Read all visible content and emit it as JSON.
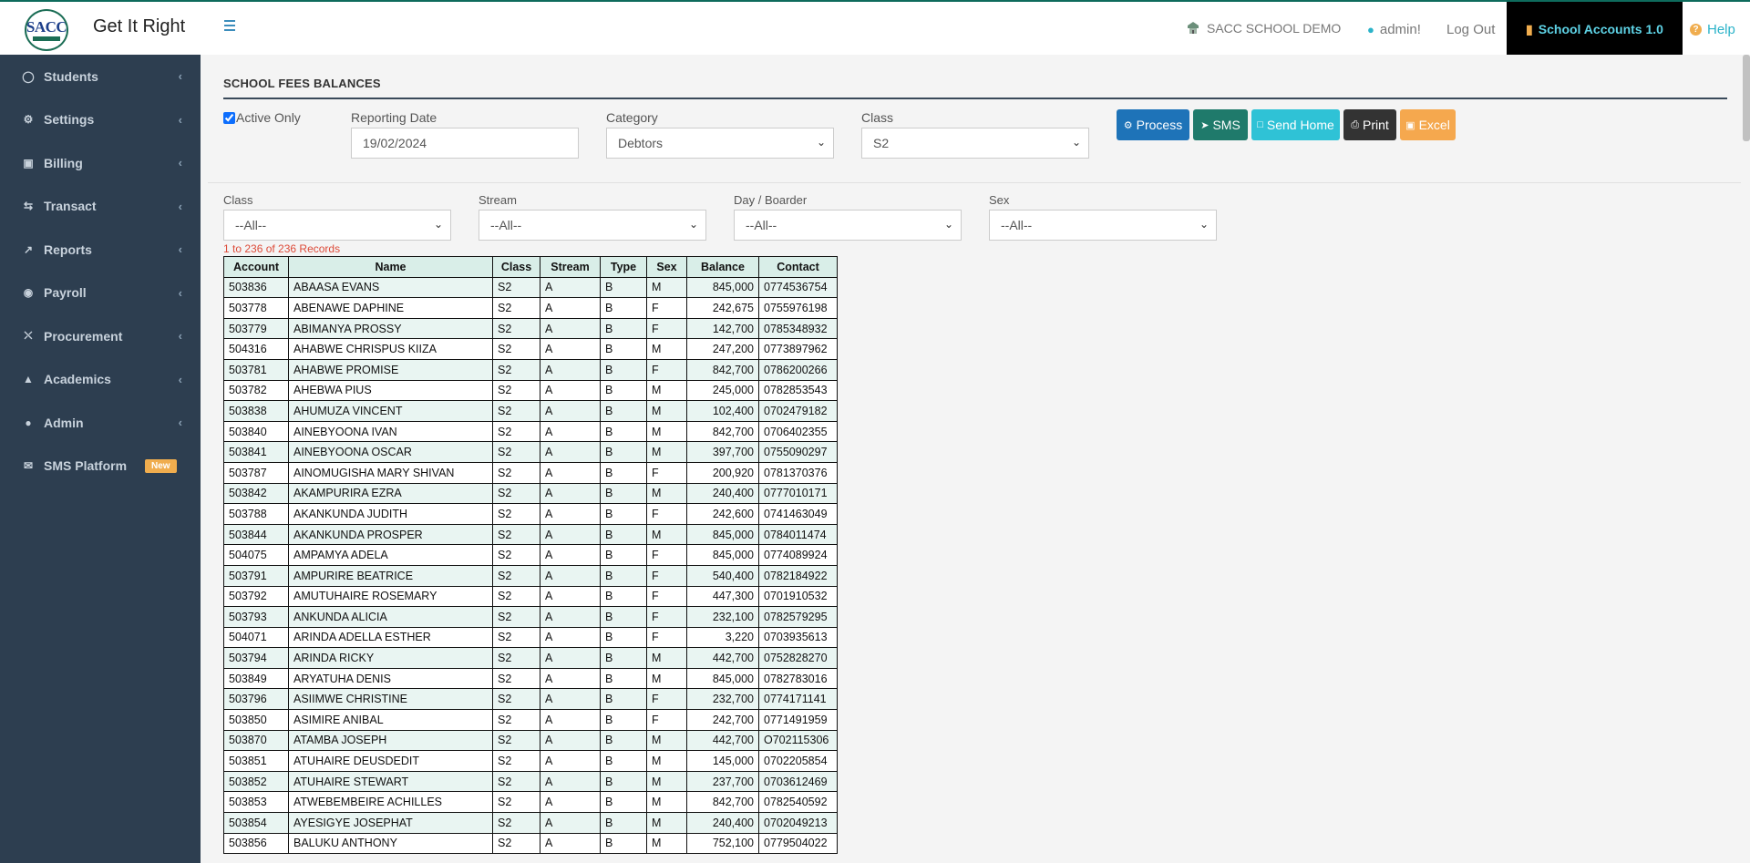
{
  "header": {
    "logo_text": "SACC",
    "app_title": "Get It Right",
    "school_name": "SACC SCHOOL DEMO",
    "user": "admin!",
    "logout": "Log Out",
    "accounts": "School Accounts 1.0",
    "help": "Help"
  },
  "sidebar": {
    "items": [
      {
        "label": "Students",
        "icon": "user-icon"
      },
      {
        "label": "Settings",
        "icon": "gears-icon"
      },
      {
        "label": "Billing",
        "icon": "money-icon"
      },
      {
        "label": "Transact",
        "icon": "exchange-icon"
      },
      {
        "label": "Reports",
        "icon": "line-chart-icon"
      },
      {
        "label": "Payroll",
        "icon": "eye-icon"
      },
      {
        "label": "Procurement",
        "icon": "cart-icon"
      },
      {
        "label": "Academics",
        "icon": "graduation-cap-icon"
      },
      {
        "label": "Admin",
        "icon": "globe-icon"
      }
    ],
    "sms": {
      "label": "SMS Platform",
      "badge": "New",
      "icon": "envelope-icon"
    }
  },
  "panel": {
    "title": "SCHOOL FEES BALANCES",
    "active_only": "Active Only",
    "reporting_date_label": "Reporting Date",
    "reporting_date": "19/02/2024",
    "category_label": "Category",
    "category": "Debtors",
    "class_label": "Class",
    "class": "S2",
    "buttons": {
      "process": "Process",
      "sms": "SMS",
      "send_home": "Send Home",
      "print": "Print",
      "excel": "Excel"
    },
    "colors": {
      "process": "#1e73b8",
      "sms": "#1f7a6b",
      "send_home": "#2fc2d6",
      "print": "#333333",
      "excel": "#f5a84e"
    }
  },
  "filters": {
    "class_label": "Class",
    "class": "--All--",
    "stream_label": "Stream",
    "stream": "--All--",
    "day_label": "Day / Boarder",
    "day": "--All--",
    "sex_label": "Sex",
    "sex": "--All--"
  },
  "records": "1 to 236 of 236 Records",
  "table": {
    "headers": [
      "Account",
      "Name",
      "Class",
      "Stream",
      "Type",
      "Sex",
      "Balance",
      "Contact"
    ],
    "rows": [
      [
        "503836",
        "ABAASA EVANS",
        "S2",
        "A",
        "B",
        "M",
        "845,000",
        "0774536754"
      ],
      [
        "503778",
        "ABENAWE DAPHINE",
        "S2",
        "A",
        "B",
        "F",
        "242,675",
        "0755976198"
      ],
      [
        "503779",
        "ABIMANYA PROSSY",
        "S2",
        "A",
        "B",
        "F",
        "142,700",
        "0785348932"
      ],
      [
        "504316",
        "AHABWE CHRISPUS KIIZA",
        "S2",
        "A",
        "B",
        "M",
        "247,200",
        "0773897962"
      ],
      [
        "503781",
        "AHABWE PROMISE",
        "S2",
        "A",
        "B",
        "F",
        "842,700",
        "0786200266"
      ],
      [
        "503782",
        "AHEBWA PIUS",
        "S2",
        "A",
        "B",
        "M",
        "245,000",
        "0782853543"
      ],
      [
        "503838",
        "AHUMUZA VINCENT",
        "S2",
        "A",
        "B",
        "M",
        "102,400",
        "0702479182"
      ],
      [
        "503840",
        "AINEBYOONA IVAN",
        "S2",
        "A",
        "B",
        "M",
        "842,700",
        "0706402355"
      ],
      [
        "503841",
        "AINEBYOONA OSCAR",
        "S2",
        "A",
        "B",
        "M",
        "397,700",
        "0755090297"
      ],
      [
        "503787",
        "AINOMUGISHA MARY SHIVAN",
        "S2",
        "A",
        "B",
        "F",
        "200,920",
        "0781370376"
      ],
      [
        "503842",
        "AKAMPURIRA EZRA",
        "S2",
        "A",
        "B",
        "M",
        "240,400",
        "0777010171"
      ],
      [
        "503788",
        "AKANKUNDA JUDITH",
        "S2",
        "A",
        "B",
        "F",
        "242,600",
        "0741463049"
      ],
      [
        "503844",
        "AKANKUNDA PROSPER",
        "S2",
        "A",
        "B",
        "M",
        "845,000",
        "0784011474"
      ],
      [
        "504075",
        "AMPAMYA ADELA",
        "S2",
        "A",
        "B",
        "F",
        "845,000",
        "0774089924"
      ],
      [
        "503791",
        "AMPURIRE BEATRICE",
        "S2",
        "A",
        "B",
        "F",
        "540,400",
        "0782184922"
      ],
      [
        "503792",
        "AMUTUHAIRE ROSEMARY",
        "S2",
        "A",
        "B",
        "F",
        "447,300",
        "0701910532"
      ],
      [
        "503793",
        "ANKUNDA ALICIA",
        "S2",
        "A",
        "B",
        "F",
        "232,100",
        "0782579295"
      ],
      [
        "504071",
        "ARINDA ADELLA ESTHER",
        "S2",
        "A",
        "B",
        "F",
        "3,220",
        "0703935613"
      ],
      [
        "503794",
        "ARINDA RICKY",
        "S2",
        "A",
        "B",
        "M",
        "442,700",
        "0752828270"
      ],
      [
        "503849",
        "ARYATUHA DENIS",
        "S2",
        "A",
        "B",
        "M",
        "845,000",
        "0782783016"
      ],
      [
        "503796",
        "ASIIMWE CHRISTINE",
        "S2",
        "A",
        "B",
        "F",
        "232,700",
        "0774171141"
      ],
      [
        "503850",
        "ASIMIRE ANIBAL",
        "S2",
        "A",
        "B",
        "F",
        "242,700",
        "0771491959"
      ],
      [
        "503870",
        "ATAMBA JOSEPH",
        "S2",
        "A",
        "B",
        "M",
        "442,700",
        "O702115306"
      ],
      [
        "503851",
        "ATUHAIRE DEUSDEDIT",
        "S2",
        "A",
        "B",
        "M",
        "145,000",
        "0702205854"
      ],
      [
        "503852",
        "ATUHAIRE STEWART",
        "S2",
        "A",
        "B",
        "M",
        "237,700",
        "0703612469"
      ],
      [
        "503853",
        "ATWEBEMBEIRE ACHILLES",
        "S2",
        "A",
        "B",
        "M",
        "842,700",
        "0782540592"
      ],
      [
        "503854",
        "AYESIGYE JOSEPHAT",
        "S2",
        "A",
        "B",
        "M",
        "240,400",
        "0702049213"
      ],
      [
        "503856",
        "BALUKU ANTHONY",
        "S2",
        "A",
        "B",
        "M",
        "752,100",
        "0779504022"
      ]
    ]
  }
}
